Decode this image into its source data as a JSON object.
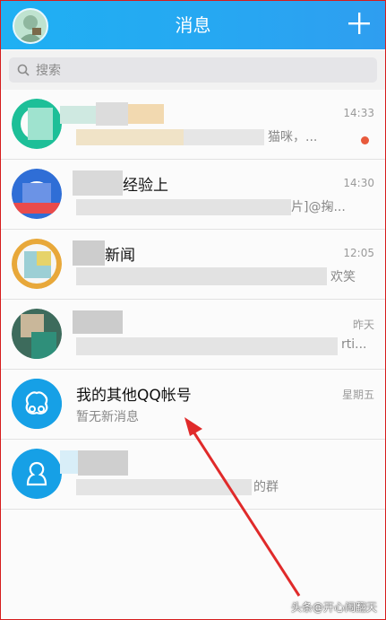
{
  "header": {
    "title": "消息",
    "add_icon": "plus-icon",
    "accent": "#27a7f2"
  },
  "search": {
    "placeholder": "搜索"
  },
  "conversations": [
    {
      "name": "",
      "preview": "猫咪，...",
      "time": "14:33",
      "unread": true
    },
    {
      "name": "经验上",
      "preview": "片]@掬...",
      "time": "14:30"
    },
    {
      "name": "新闻",
      "preview": "欢笑",
      "time": "12:05"
    },
    {
      "name": "",
      "preview": "rti...",
      "time": "昨天"
    },
    {
      "name": "我的其他QQ帐号",
      "preview": "暂无新消息",
      "time": "星期五"
    },
    {
      "name": "",
      "preview": "的群",
      "time": ""
    }
  ],
  "watermark": "头条@开心闹翻天",
  "annotation_color": "#e02a2a"
}
